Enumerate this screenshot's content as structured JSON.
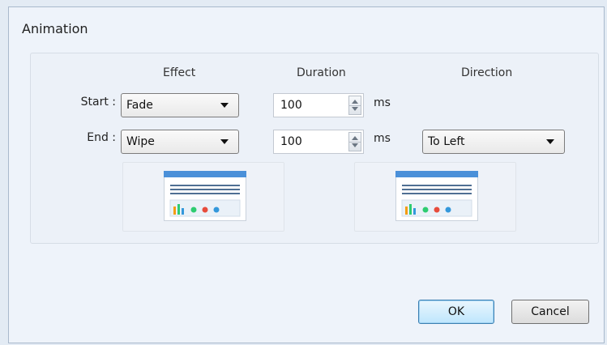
{
  "dialog": {
    "title": "Animation",
    "headers": {
      "effect": "Effect",
      "duration": "Duration",
      "direction": "Direction"
    },
    "rows": {
      "start": {
        "label": "Start :",
        "effect": "Fade",
        "duration": "100",
        "unit": "ms"
      },
      "end": {
        "label": "End :",
        "effect": "Wipe",
        "duration": "100",
        "unit": "ms",
        "direction": "To Left"
      }
    },
    "buttons": {
      "ok": "OK",
      "cancel": "Cancel"
    },
    "icons": [
      "chevron-down-icon",
      "spin-up-icon",
      "spin-down-icon",
      "window-chart-preview-icon"
    ]
  }
}
